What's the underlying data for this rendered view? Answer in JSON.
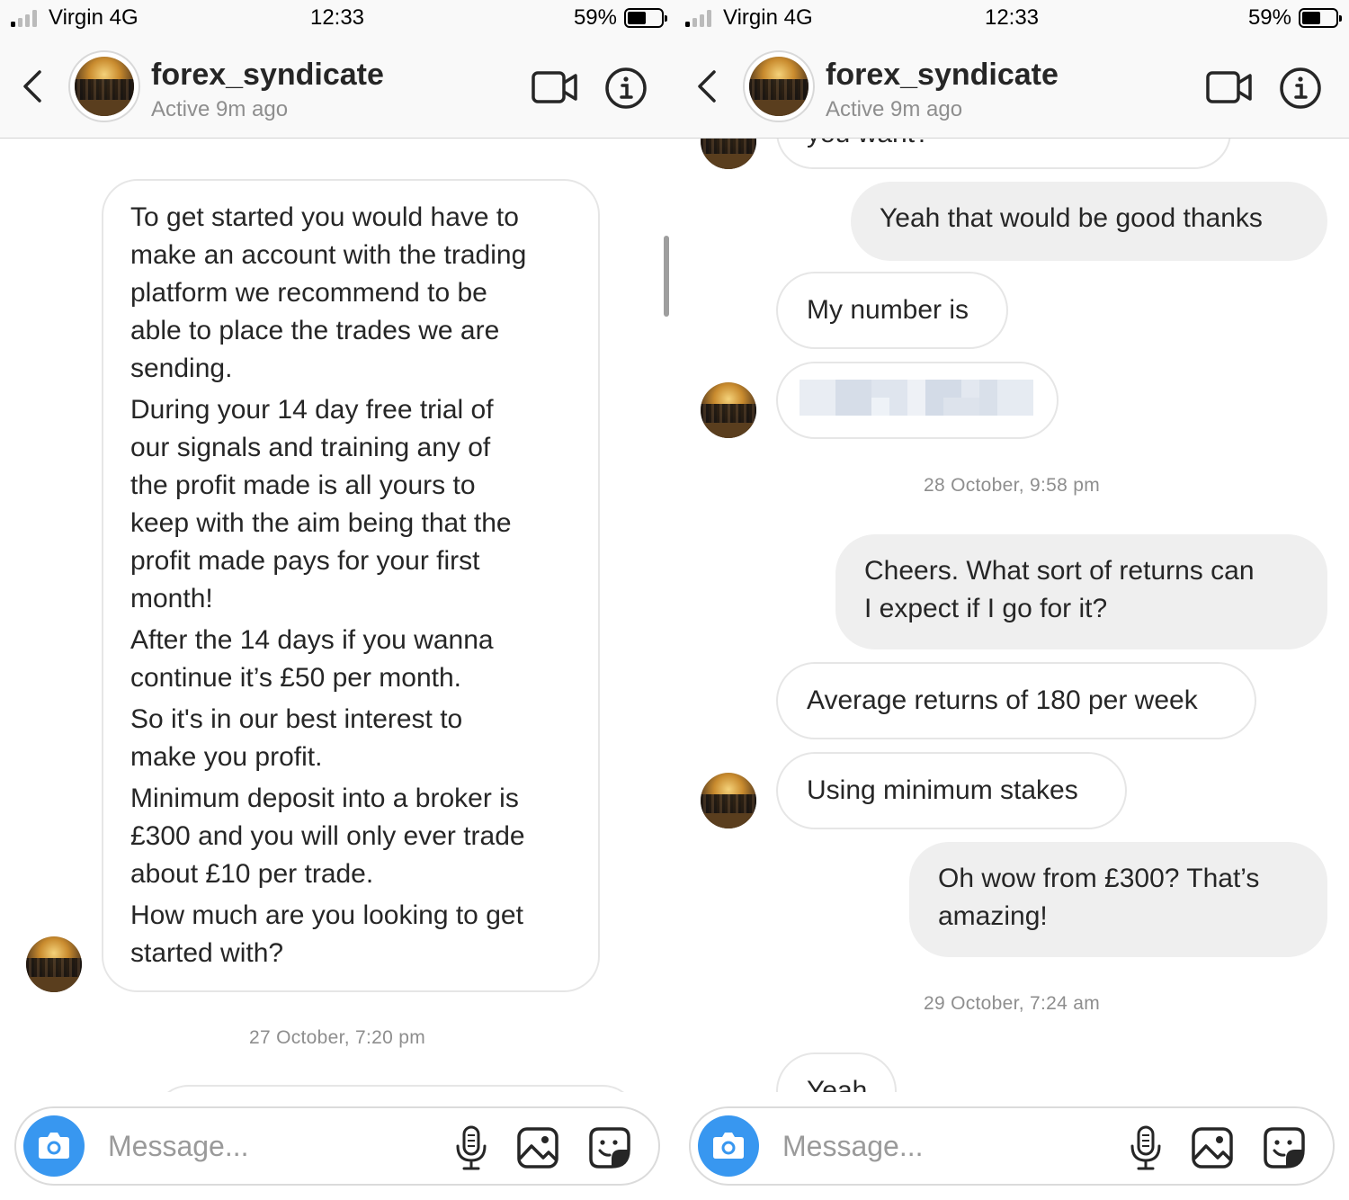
{
  "colors": {
    "accent": "#3897f0",
    "bubble_out": "#efefef",
    "bubble_in_border": "#e6e6e6",
    "muted_text": "#8e8e8e"
  },
  "screens": [
    {
      "status": {
        "carrier": "Virgin 4G",
        "time": "12:33",
        "battery": "59%"
      },
      "header": {
        "username": "forex_syndicate",
        "activity": "Active 9m ago"
      },
      "messages": {
        "m1_lines": [
          "To get started you would have to",
          "make an account with the trading",
          "platform we recommend to be",
          "able to place the trades we are",
          "sending.",
          "During your 14 day free trial of",
          "our signals and training any of",
          "the profit made is all yours to",
          "keep with the aim being that the",
          "profit made pays for your first",
          "month!",
          "After the 14 days if you wanna",
          "continue it’s £50 per month.",
          "So it's in our best interest to",
          "make you profit.",
          "Minimum deposit into a broker is",
          "£300 and you will only ever trade",
          "about £10 per trade.",
          "How much are you looking to get",
          "started with?"
        ],
        "ts1": "27 October, 7:20 pm"
      },
      "composer": {
        "placeholder": "Message..."
      }
    },
    {
      "status": {
        "carrier": "Virgin 4G",
        "time": "12:33",
        "battery": "59%"
      },
      "header": {
        "username": "forex_syndicate",
        "activity": "Active 9m ago"
      },
      "messages": {
        "partial_top": "you want?",
        "out1": "Yeah that would be good thanks",
        "in1": "My number is",
        "ts1": "28 October, 9:58 pm",
        "out2_l1": "Cheers. What sort of returns can",
        "out2_l2": "I expect if I go for it?",
        "in3": "Average returns of 180 per week",
        "in4": "Using minimum stakes",
        "out3_l1": "Oh wow from £300? That’s",
        "out3_l2": "amazing!",
        "ts2": "29 October, 7:24 am",
        "in5": "Yeah"
      },
      "composer": {
        "placeholder": "Message..."
      }
    }
  ]
}
